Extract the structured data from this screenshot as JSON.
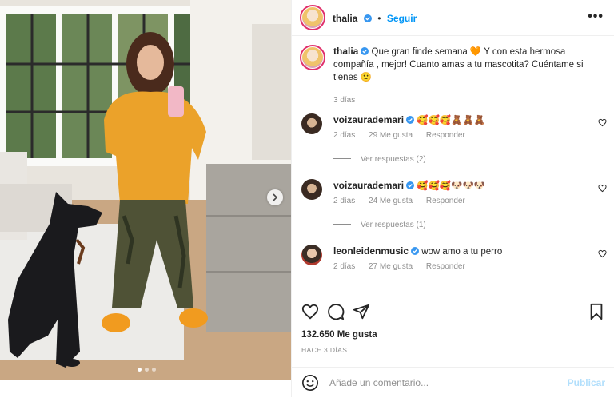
{
  "colors": {
    "accent": "#0095f6",
    "ring": "#e0306b",
    "muted": "#8e8e8e",
    "verified": "#3897f0"
  },
  "post_image": {
    "carousel_total": 3,
    "carousel_index": 1
  },
  "header": {
    "username": "thalia",
    "follow_label": "Seguir",
    "more_icon": "more-horizontal-icon"
  },
  "caption": {
    "username": "thalia",
    "text": "Que gran finde semana 🧡 Y con esta hermosa compañía , mejor! Cuanto amas a tu mascotita? Cuéntame si tienes 🙂",
    "time": "3 días"
  },
  "comments": [
    {
      "username": "voizaurademari",
      "text": "🥰🥰🥰🧸🧸🧸",
      "time": "2 días",
      "likes": "29 Me gusta",
      "reply": "Responder",
      "view_replies": "Ver respuestas (2)"
    },
    {
      "username": "voizaurademari",
      "text": "🥰🥰🥰🐶🐶🐶",
      "time": "2 días",
      "likes": "24 Me gusta",
      "reply": "Responder",
      "view_replies": "Ver respuestas (1)"
    },
    {
      "username": "leonleidenmusic",
      "text": "wow amo a tu perro",
      "time": "2 días",
      "likes": "27 Me gusta",
      "reply": "Responder"
    }
  ],
  "stats": {
    "likes": "132.650 Me gusta",
    "posted": "HACE 3 DÍAS"
  },
  "add_comment": {
    "placeholder": "Añade un comentario...",
    "publish_label": "Publicar",
    "emoji_icon": "smiley-icon"
  }
}
